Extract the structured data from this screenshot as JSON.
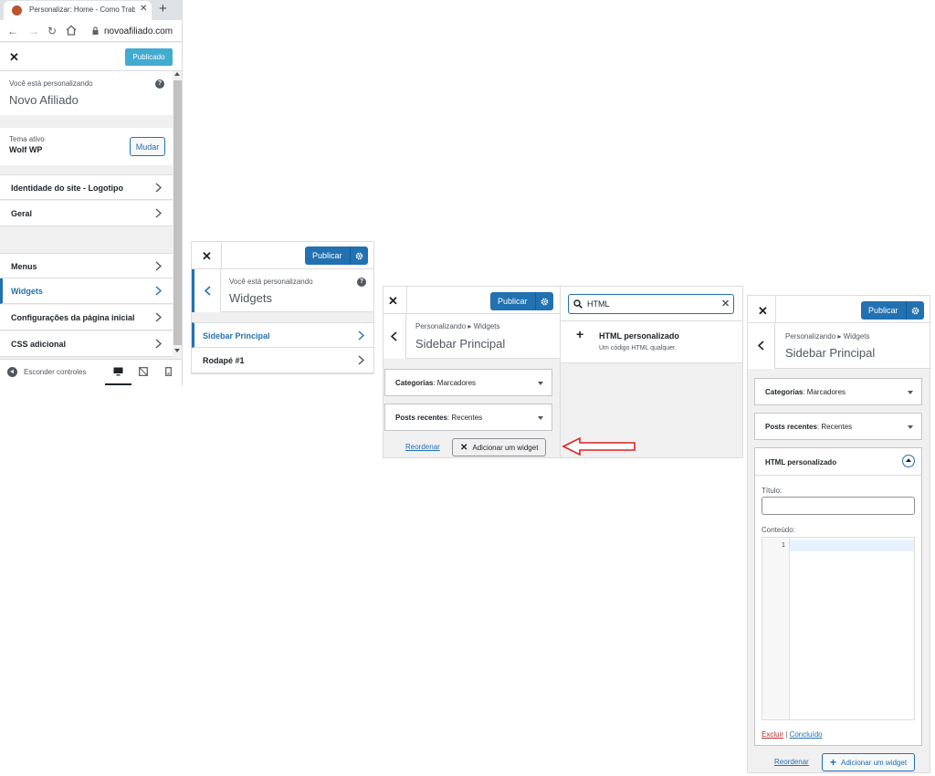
{
  "browser": {
    "tab_title": "Personalizar: Home - Como Trabalhar",
    "tab_close": "✕",
    "new_tab": "+",
    "url": "novoafiliado.com"
  },
  "customizer": {
    "close": "✕",
    "published_button": "Publicado",
    "customizing_label": "Você está personalizando",
    "site_name": "Novo Afiliado",
    "active_theme_label": "Tema ativo",
    "active_theme_name": "Wolf WP",
    "change_button": "Mudar",
    "sections": [
      {
        "label": "Identidade do site - Logotipo"
      },
      {
        "label": "Geral"
      },
      {
        "label": "Menus"
      },
      {
        "label": "Widgets"
      },
      {
        "label": "Configurações da página inicial"
      },
      {
        "label": "CSS adicional"
      }
    ],
    "hide_controls": "Esconder controles",
    "help": "?"
  },
  "widgets_panel": {
    "close": "✕",
    "publish_button": "Publicar",
    "customizing_label": "Você está personalizando",
    "title": "Widgets",
    "areas": [
      {
        "label": "Sidebar Principal"
      },
      {
        "label": "Rodapé #1"
      }
    ]
  },
  "sidebar_panel": {
    "close": "✕",
    "publish_button": "Publicar",
    "breadcrumb": "Personalizando ▸ Widgets",
    "title": "Sidebar Principal",
    "widgets": [
      {
        "name": "Categorias",
        "subtitle": ": Marcadores"
      },
      {
        "name": "Posts recentes",
        "subtitle": ": Recentes"
      }
    ],
    "reorder": "Reordenar",
    "add_widget": "Adicionar um widget"
  },
  "widget_search": {
    "query": "HTML",
    "result_title": "HTML personalizado",
    "result_desc": "Um código HTML qualquer."
  },
  "html_widget_panel": {
    "close": "✕",
    "publish_button": "Publicar",
    "breadcrumb": "Personalizando ▸ Widgets",
    "title": "Sidebar Principal",
    "widgets": [
      {
        "name": "Categorias",
        "subtitle": ": Marcadores"
      },
      {
        "name": "Posts recentes",
        "subtitle": ": Recentes"
      }
    ],
    "html_widget_title": "HTML personalizado",
    "title_label": "Título:",
    "content_label": "Conteúdo:",
    "line_number": "1",
    "delete": "Excluir",
    "separator": "|",
    "done": "Concluído",
    "reorder": "Reordenar",
    "add_widget": "Adicionar um widget"
  },
  "colors": {
    "accent": "#2271b1",
    "published": "#2ea2cc",
    "arrow": "#e02020"
  }
}
